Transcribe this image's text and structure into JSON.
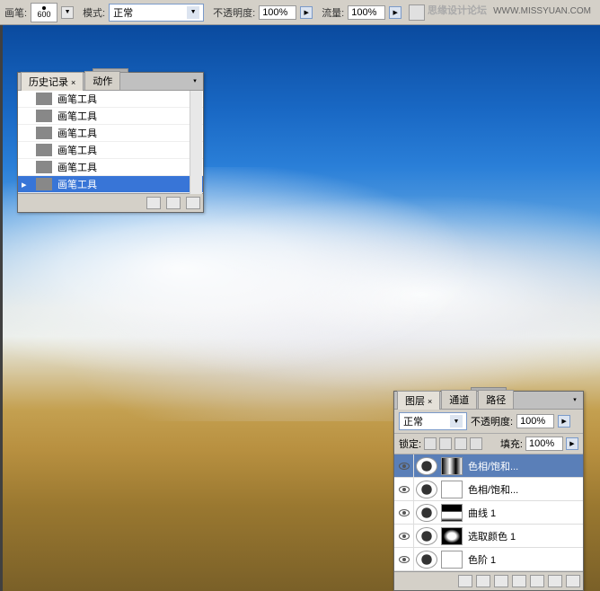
{
  "toolbar": {
    "brush_label": "画笔:",
    "brush_size": "600",
    "mode_label": "模式:",
    "mode_value": "正常",
    "opacity_label": "不透明度:",
    "opacity_value": "100%",
    "flow_label": "流量:",
    "flow_value": "100%"
  },
  "watermark": {
    "text": "思缘设计论坛",
    "url": "WWW.MISSYUAN.COM"
  },
  "history_panel": {
    "tab_history": "历史记录",
    "tab_actions": "动作",
    "items": [
      {
        "label": "画笔工具",
        "selected": false
      },
      {
        "label": "画笔工具",
        "selected": false
      },
      {
        "label": "画笔工具",
        "selected": false
      },
      {
        "label": "画笔工具",
        "selected": false
      },
      {
        "label": "画笔工具",
        "selected": false
      },
      {
        "label": "画笔工具",
        "selected": true
      }
    ]
  },
  "layers_panel": {
    "tab_layers": "图层",
    "tab_channels": "通道",
    "tab_paths": "路径",
    "blend_mode": "正常",
    "opacity_label": "不透明度:",
    "opacity_value": "100%",
    "lock_label": "锁定:",
    "fill_label": "填充:",
    "fill_value": "100%",
    "layers": [
      {
        "name": "色相/饱和...",
        "mask": "gradient",
        "selected": true
      },
      {
        "name": "色相/饱和...",
        "mask": "white",
        "selected": false
      },
      {
        "name": "曲线 1",
        "mask": "cloud1",
        "selected": false
      },
      {
        "name": "选取颜色 1",
        "mask": "cloud2",
        "selected": false
      },
      {
        "name": "色阶 1",
        "mask": "white",
        "selected": false
      }
    ]
  }
}
